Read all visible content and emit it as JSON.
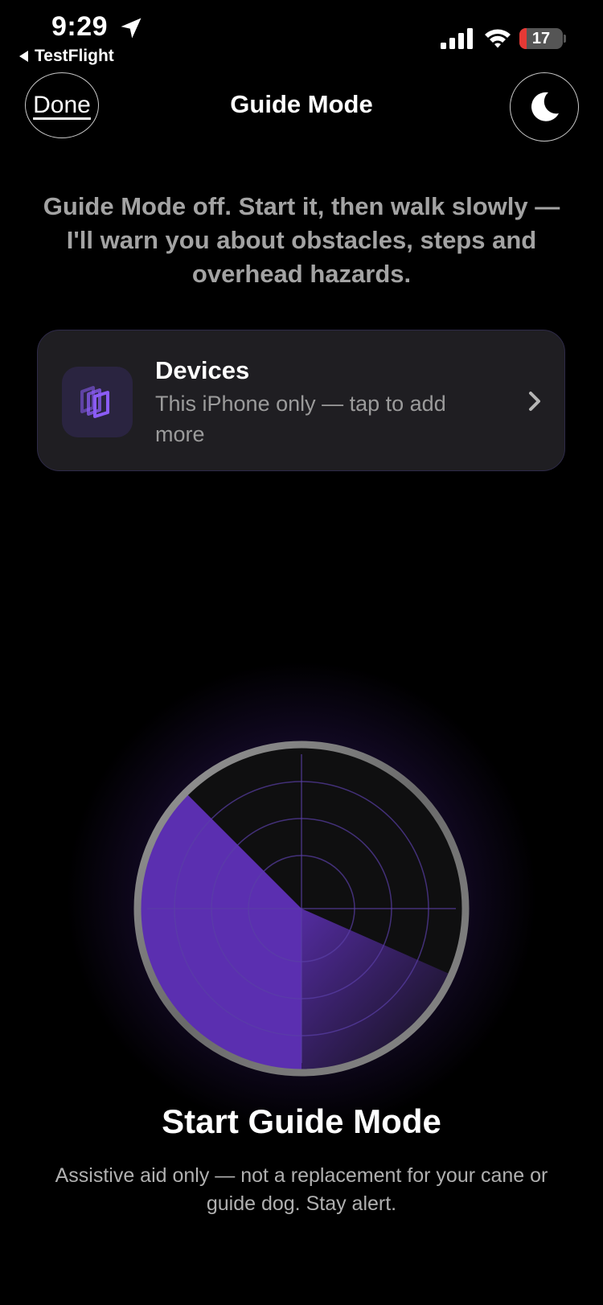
{
  "status_bar": {
    "time": "9:29",
    "back_app": "TestFlight",
    "battery_level": "17",
    "battery_color": "#e53935"
  },
  "nav": {
    "done_label": "Done",
    "title": "Guide Mode",
    "theme_icon": "moon-icon"
  },
  "status_message": "Guide Mode off. Start it, then walk slowly — I'll warn you about obstacles, steps and overhead hazards.",
  "devices": {
    "title": "Devices",
    "subtitle": "This iPhone only — tap to add more",
    "icon": "devices-stack-icon",
    "accent": "#8b5cf6"
  },
  "start_button": {
    "label": "Start Guide Mode",
    "radar_icon": "radar-icon",
    "sweep_color": "#5b2fb0"
  },
  "disclaimer": "Assistive aid only — not a replacement for your cane or guide dog. Stay alert."
}
